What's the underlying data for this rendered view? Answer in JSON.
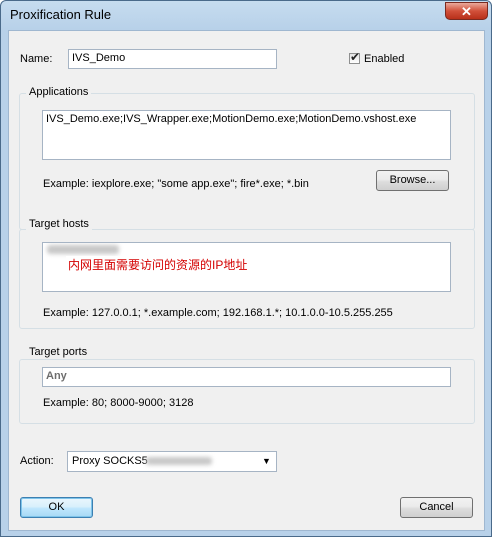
{
  "window": {
    "title": "Proxification Rule",
    "close_glyph": "✕"
  },
  "name": {
    "label": "Name:",
    "value": "IVS_Demo"
  },
  "enabled": {
    "label": "Enabled",
    "checked": true
  },
  "applications": {
    "title": "Applications",
    "value": "IVS_Demo.exe;IVS_Wrapper.exe;MotionDemo.exe;MotionDemo.vshost.exe",
    "example": "Example: iexplore.exe; \"some app.exe\"; fire*.exe; *.bin",
    "browse_label": "Browse..."
  },
  "target_hosts": {
    "title": "Target hosts",
    "annotation": "内网里面需要访问的资源的IP地址",
    "example": "Example: 127.0.0.1; *.example.com; 192.168.1.*; 10.1.0.0-10.5.255.255"
  },
  "target_ports": {
    "title": "Target ports",
    "value": "Any",
    "example": "Example: 80; 8000-9000; 3128"
  },
  "action": {
    "label": "Action:",
    "value": "Proxy SOCKS5",
    "dropdown_glyph": "▼"
  },
  "buttons": {
    "ok": "OK",
    "cancel": "Cancel"
  },
  "icons": {
    "close": "close-icon",
    "dropdown": "chevron-down-icon",
    "check": "checkmark-icon"
  }
}
